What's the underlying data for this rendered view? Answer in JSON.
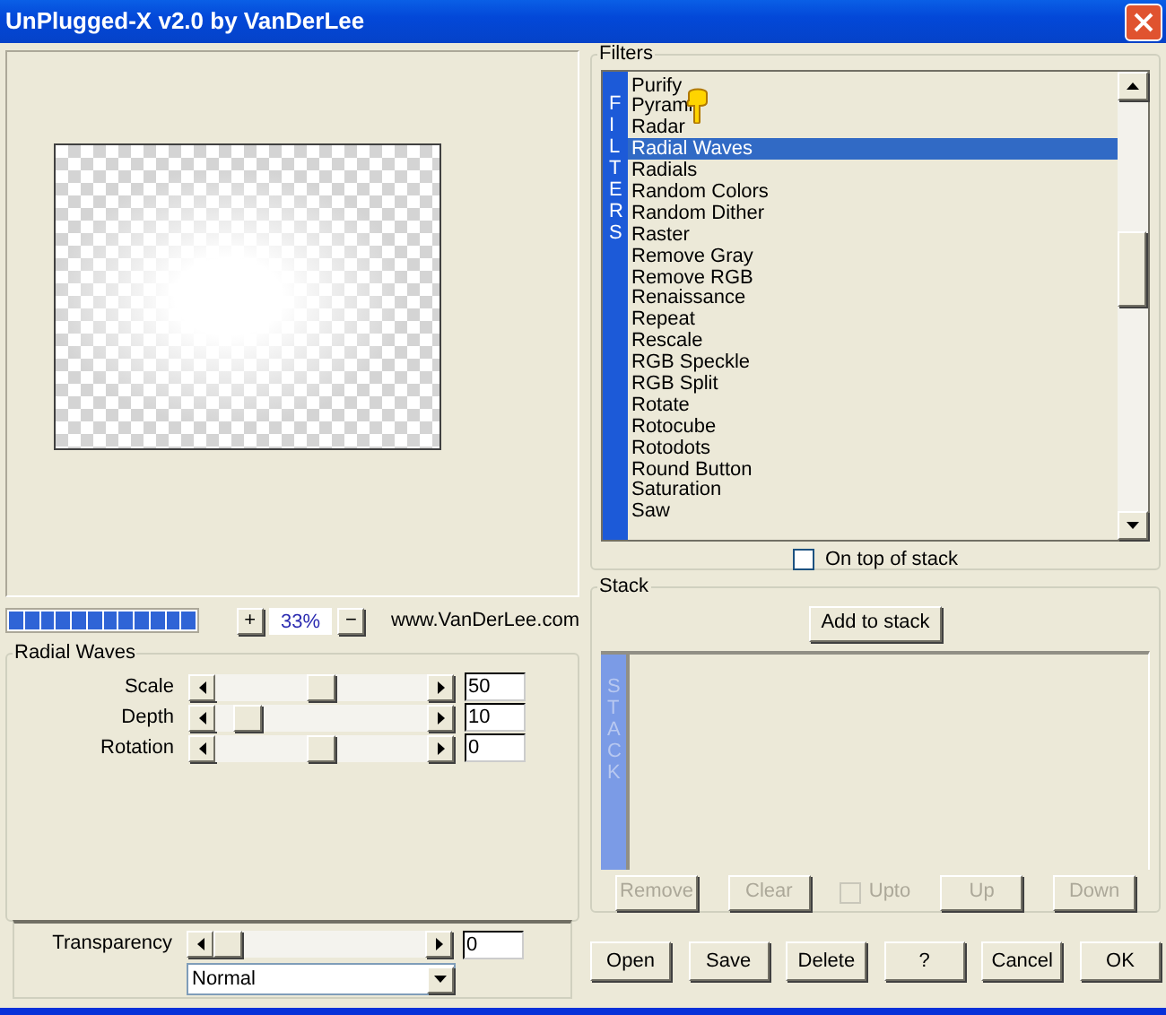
{
  "window": {
    "title": "UnPlugged-X v2.0 by VanDerLee"
  },
  "preview": {
    "progress": {
      "level": 1
    },
    "zoom_in": "+",
    "zoom": "33%",
    "zoom_out": "−",
    "website": "www.VanDerLee.com"
  },
  "parameters": {
    "title": "Radial Waves",
    "sliders": [
      {
        "label": "Scale",
        "value": "50",
        "level": 0.5
      },
      {
        "label": "Depth",
        "value": "10",
        "level": 0.1
      },
      {
        "label": "Rotation",
        "value": "0",
        "level": 0.5
      }
    ]
  },
  "transparency": {
    "label": "Transparency",
    "value": "0",
    "level": 0,
    "blend_mode": "Normal"
  },
  "filters": {
    "title": "Filters",
    "side_label": "FILTERS",
    "items": [
      {
        "label": "Purify",
        "selected": false
      },
      {
        "label": "Pyrami",
        "selected": false,
        "cursor": true
      },
      {
        "label": "Radar",
        "selected": false
      },
      {
        "label": "Radial Waves",
        "selected": true
      },
      {
        "label": "Radials",
        "selected": false
      },
      {
        "label": "Random Colors",
        "selected": false
      },
      {
        "label": "Random Dither",
        "selected": false
      },
      {
        "label": "Raster",
        "selected": false
      },
      {
        "label": "Remove Gray",
        "selected": false
      },
      {
        "label": "Remove RGB",
        "selected": false
      },
      {
        "label": "Renaissance",
        "selected": false
      },
      {
        "label": "Repeat",
        "selected": false
      },
      {
        "label": "Rescale",
        "selected": false
      },
      {
        "label": "RGB Speckle",
        "selected": false
      },
      {
        "label": "RGB Split",
        "selected": false
      },
      {
        "label": "Rotate",
        "selected": false
      },
      {
        "label": "Rotocube",
        "selected": false
      },
      {
        "label": "Rotodots",
        "selected": false
      },
      {
        "label": "Round Button",
        "selected": false
      },
      {
        "label": "Saturation",
        "selected": false
      },
      {
        "label": "Saw",
        "selected": false
      }
    ],
    "on_top_of_stack": {
      "label": "On top of stack",
      "checked": false
    }
  },
  "stack": {
    "title": "Stack",
    "side_label": "STACK",
    "add_button": "Add to stack",
    "controls": [
      {
        "kind": "button",
        "label": "Remove",
        "disabled": true
      },
      {
        "kind": "button",
        "label": "Clear",
        "disabled": true
      },
      {
        "kind": "checkbox",
        "label": "Upto",
        "checked": false,
        "disabled": true
      },
      {
        "kind": "button",
        "label": "Up",
        "disabled": true
      },
      {
        "kind": "button",
        "label": "Down",
        "disabled": true
      }
    ]
  },
  "buttons": [
    "Open",
    "Save",
    "Delete",
    "?",
    "Cancel",
    "OK"
  ]
}
